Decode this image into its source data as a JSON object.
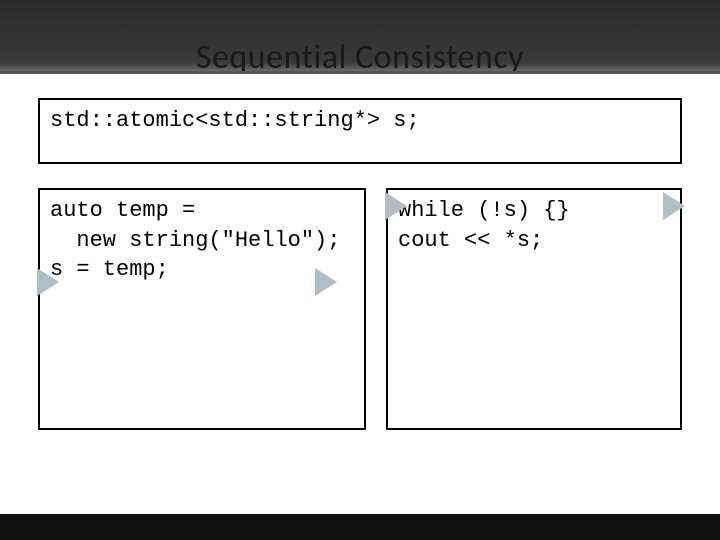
{
  "title": "Sequential Consistency",
  "code_top": "std::atomic<std::string*> s;",
  "code_left_line1": "auto temp =",
  "code_left_line2": "  new string(\"Hello\");",
  "code_left_line3": "s = temp;",
  "code_right_line1": "while (!s) {}",
  "code_right_line2": "cout << *s;",
  "triangle_color": "#b0bfc6"
}
